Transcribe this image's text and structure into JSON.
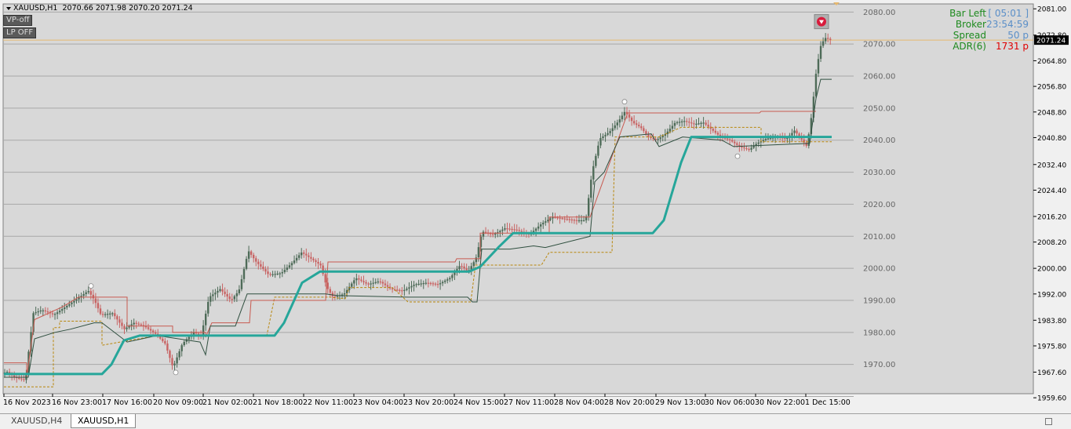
{
  "header": {
    "symbol": "XAUUSD,H1",
    "ohlc": "2070.66 2071.98 2070.20 2071.24"
  },
  "buttons": {
    "vp": "VP-off",
    "lp": "LP OFF"
  },
  "info_panel": [
    {
      "label": "Bar Left",
      "value": "[ 05:01 ]",
      "color": "#5b8fc8"
    },
    {
      "label": "Broker",
      "value": "23:54:59",
      "color": "#5b8fc8"
    },
    {
      "label": "Spread",
      "value": "50 p",
      "color": "#5b8fc8"
    },
    {
      "label": "ADR(6)",
      "value": "1731 p",
      "color": "#e00000"
    }
  ],
  "tabs": [
    {
      "label": "XAUUSD,H4",
      "active": false
    },
    {
      "label": "XAUUSD,H1",
      "active": true
    }
  ],
  "colors": {
    "background": "#d8d8d8",
    "grid": "#a8a8a8",
    "bull_candle": "#4e6b58",
    "bear_candle": "#c86464",
    "teal_line": "#26a69a",
    "red_line": "#c85a50",
    "dark_line": "#2f4f3f",
    "dashed_line": "#b8860b",
    "price_line": "#e6b86e",
    "price_label_bg": "#000000"
  },
  "chart_data": {
    "type": "candlestick",
    "y_ticks_left": [
      "2080.00",
      "2070.00",
      "2060.00",
      "2050.00",
      "2040.00",
      "2030.00",
      "2020.00",
      "2010.00",
      "2000.00",
      "1990.00",
      "1980.00",
      "1970.00"
    ],
    "y_ticks_right": [
      "2081.00",
      "2072.80",
      "2064.80",
      "2056.80",
      "2048.80",
      "2040.80",
      "2032.40",
      "2024.40",
      "2016.20",
      "2008.20",
      "2000.00",
      "1992.00",
      "1983.80",
      "1975.80",
      "1967.60",
      "1959.60"
    ],
    "y_ticks_right_note": "2072.80 tick is covered by the 2071.24 price label and not shown",
    "current_price": "2071.24",
    "current_price_value": 2071.24,
    "ylim": [
      1959.6,
      2083.0
    ],
    "x_ticks": [
      "16 Nov 2023",
      "16 Nov 23:00",
      "17 Nov 16:00",
      "20 Nov 09:00",
      "21 Nov 02:00",
      "21 Nov 18:00",
      "22 Nov 11:00",
      "23 Nov 04:00",
      "23 Nov 20:00",
      "24 Nov 15:00",
      "27 Nov 11:00",
      "28 Nov 04:00",
      "28 Nov 20:00",
      "29 Nov 13:00",
      "30 Nov 06:00",
      "30 Nov 22:00",
      "1 Dec 15:00"
    ],
    "price_path": [
      [
        0,
        1966.5
      ],
      [
        10,
        1967.8
      ],
      [
        20,
        1966.0
      ],
      [
        28,
        1965.5
      ],
      [
        34,
        1965.0
      ],
      [
        38,
        1974.0
      ],
      [
        44,
        1986.0
      ],
      [
        55,
        1987.0
      ],
      [
        70,
        1985.5
      ],
      [
        85,
        1988.0
      ],
      [
        100,
        1990.5
      ],
      [
        114,
        1993.0
      ],
      [
        122,
        1990.0
      ],
      [
        130,
        1985.5
      ],
      [
        145,
        1986.0
      ],
      [
        160,
        1981.0
      ],
      [
        172,
        1983.0
      ],
      [
        185,
        1982.0
      ],
      [
        200,
        1979.5
      ],
      [
        212,
        1976.5
      ],
      [
        222,
        1969.0
      ],
      [
        234,
        1976.5
      ],
      [
        248,
        1980.0
      ],
      [
        258,
        1979.0
      ],
      [
        268,
        1991.0
      ],
      [
        282,
        1993.5
      ],
      [
        296,
        1990.0
      ],
      [
        306,
        1993.0
      ],
      [
        318,
        2005.5
      ],
      [
        328,
        2002.0
      ],
      [
        344,
        1998.0
      ],
      [
        360,
        1998.5
      ],
      [
        375,
        2002.0
      ],
      [
        386,
        2005.0
      ],
      [
        398,
        2003.0
      ],
      [
        410,
        2001.0
      ],
      [
        418,
        1994.0
      ],
      [
        426,
        1991.0
      ],
      [
        440,
        1992.0
      ],
      [
        455,
        1997.0
      ],
      [
        470,
        1995.0
      ],
      [
        485,
        1996.0
      ],
      [
        500,
        1993.5
      ],
      [
        515,
        1993.0
      ],
      [
        530,
        1995.0
      ],
      [
        545,
        1995.5
      ],
      [
        560,
        1995.0
      ],
      [
        575,
        1997.0
      ],
      [
        588,
        2001.0
      ],
      [
        598,
        1999.0
      ],
      [
        608,
        2003.0
      ],
      [
        616,
        2011.5
      ],
      [
        630,
        2010.5
      ],
      [
        645,
        2012.5
      ],
      [
        660,
        2012.0
      ],
      [
        676,
        2010.5
      ],
      [
        692,
        2014.0
      ],
      [
        706,
        2016.0
      ],
      [
        720,
        2015.5
      ],
      [
        735,
        2015.0
      ],
      [
        748,
        2015.0
      ],
      [
        756,
        2030.0
      ],
      [
        766,
        2040.5
      ],
      [
        778,
        2042.5
      ],
      [
        790,
        2046.0
      ],
      [
        798,
        2049.0
      ],
      [
        808,
        2045.5
      ],
      [
        818,
        2044.0
      ],
      [
        828,
        2041.0
      ],
      [
        838,
        2040.0
      ],
      [
        850,
        2042.0
      ],
      [
        862,
        2045.5
      ],
      [
        874,
        2046.0
      ],
      [
        886,
        2045.0
      ],
      [
        898,
        2045.5
      ],
      [
        910,
        2043.0
      ],
      [
        920,
        2041.0
      ],
      [
        932,
        2040.0
      ],
      [
        944,
        2038.0
      ],
      [
        956,
        2037.0
      ],
      [
        966,
        2039.0
      ],
      [
        978,
        2040.5
      ],
      [
        992,
        2041.0
      ],
      [
        1004,
        2040.5
      ],
      [
        1014,
        2043.0
      ],
      [
        1024,
        2040.0
      ],
      [
        1030,
        2038.0
      ],
      [
        1036,
        2048.0
      ],
      [
        1042,
        2062.0
      ],
      [
        1048,
        2070.0
      ],
      [
        1054,
        2072.0
      ],
      [
        1060,
        2071.24
      ]
    ],
    "teal_path": [
      [
        5,
        1967.0
      ],
      [
        130,
        1967.0
      ],
      [
        142,
        1970.0
      ],
      [
        158,
        1977.5
      ],
      [
        178,
        1979.0
      ],
      [
        350,
        1979.0
      ],
      [
        362,
        1983.0
      ],
      [
        385,
        1995.5
      ],
      [
        408,
        1999.0
      ],
      [
        598,
        1999.0
      ],
      [
        612,
        2000.5
      ],
      [
        635,
        2006.5
      ],
      [
        654,
        2011.0
      ],
      [
        832,
        2011.0
      ],
      [
        846,
        2015.0
      ],
      [
        868,
        2033.0
      ],
      [
        881,
        2041.0
      ],
      [
        1060,
        2041.0
      ]
    ],
    "red_path": [
      [
        5,
        1970.5
      ],
      [
        34,
        1970.5
      ],
      [
        34,
        1966.0
      ],
      [
        44,
        1984.0
      ],
      [
        80,
        1988.0
      ],
      [
        100,
        1991.0
      ],
      [
        132,
        1991.0
      ],
      [
        162,
        1991.0
      ],
      [
        162,
        1982.0
      ],
      [
        220,
        1982.0
      ],
      [
        220,
        1980.0
      ],
      [
        255,
        1980.0
      ],
      [
        262,
        1980.0
      ],
      [
        262,
        1978.5
      ],
      [
        270,
        1983.0
      ],
      [
        318,
        1983.0
      ],
      [
        320,
        1990.0
      ],
      [
        415,
        1990.0
      ],
      [
        418,
        2002.0
      ],
      [
        580,
        2002.0
      ],
      [
        582,
        2003.0
      ],
      [
        612,
        2003.0
      ],
      [
        612,
        2011.0
      ],
      [
        700,
        2011.0
      ],
      [
        700,
        2016.0
      ],
      [
        752,
        2016.0
      ],
      [
        800,
        2048.5
      ],
      [
        968,
        2048.5
      ],
      [
        970,
        2049.0
      ],
      [
        1040,
        2049.0
      ]
    ],
    "dark_path": [
      [
        5,
        1966.0
      ],
      [
        36,
        1966.0
      ],
      [
        44,
        1978.0
      ],
      [
        70,
        1980.0
      ],
      [
        90,
        1981.0
      ],
      [
        120,
        1983.0
      ],
      [
        130,
        1983.0
      ],
      [
        162,
        1977.0
      ],
      [
        200,
        1979.0
      ],
      [
        255,
        1977.0
      ],
      [
        262,
        1973.0
      ],
      [
        268,
        1982.0
      ],
      [
        300,
        1982.0
      ],
      [
        315,
        1992.0
      ],
      [
        350,
        1992.0
      ],
      [
        415,
        1992.0
      ],
      [
        430,
        1991.5
      ],
      [
        520,
        1991.0
      ],
      [
        596,
        1991.0
      ],
      [
        602,
        1989.5
      ],
      [
        608,
        1989.5
      ],
      [
        614,
        2006.0
      ],
      [
        650,
        2006.0
      ],
      [
        680,
        2007.0
      ],
      [
        695,
        2006.5
      ],
      [
        752,
        2010.0
      ],
      [
        758,
        2027.0
      ],
      [
        770,
        2030.0
      ],
      [
        790,
        2041.0
      ],
      [
        830,
        2042.0
      ],
      [
        840,
        2038.0
      ],
      [
        870,
        2041.0
      ],
      [
        920,
        2040.0
      ],
      [
        935,
        2038.0
      ],
      [
        1032,
        2039.0
      ],
      [
        1040,
        2053.0
      ],
      [
        1046,
        2059.0
      ],
      [
        1060,
        2059.0
      ]
    ],
    "dashed_path": [
      [
        5,
        1963.0
      ],
      [
        68,
        1963.0
      ],
      [
        68,
        1981.5
      ],
      [
        76,
        1981.5
      ],
      [
        76,
        1983.5
      ],
      [
        130,
        1983.5
      ],
      [
        130,
        1976.0
      ],
      [
        200,
        1979.0
      ],
      [
        340,
        1979.0
      ],
      [
        350,
        1991.0
      ],
      [
        420,
        1991.0
      ],
      [
        440,
        1990.5
      ],
      [
        445,
        1994.0
      ],
      [
        500,
        1994.0
      ],
      [
        520,
        1989.5
      ],
      [
        600,
        1989.5
      ],
      [
        606,
        2001.0
      ],
      [
        690,
        2001.0
      ],
      [
        700,
        2005.0
      ],
      [
        780,
        2005.0
      ],
      [
        784,
        2041.0
      ],
      [
        840,
        2041.0
      ],
      [
        868,
        2044.0
      ],
      [
        970,
        2044.0
      ],
      [
        970,
        2039.5
      ],
      [
        1060,
        2039.5
      ]
    ],
    "swing_markers": [
      {
        "x": 116,
        "y": 1994.5
      },
      {
        "x": 224,
        "y": 1967.5
      },
      {
        "x": 796,
        "y": 2052.0
      },
      {
        "x": 940,
        "y": 2035.0
      }
    ],
    "alert_icon": {
      "x": 1047,
      "y": 2077.0
    }
  }
}
